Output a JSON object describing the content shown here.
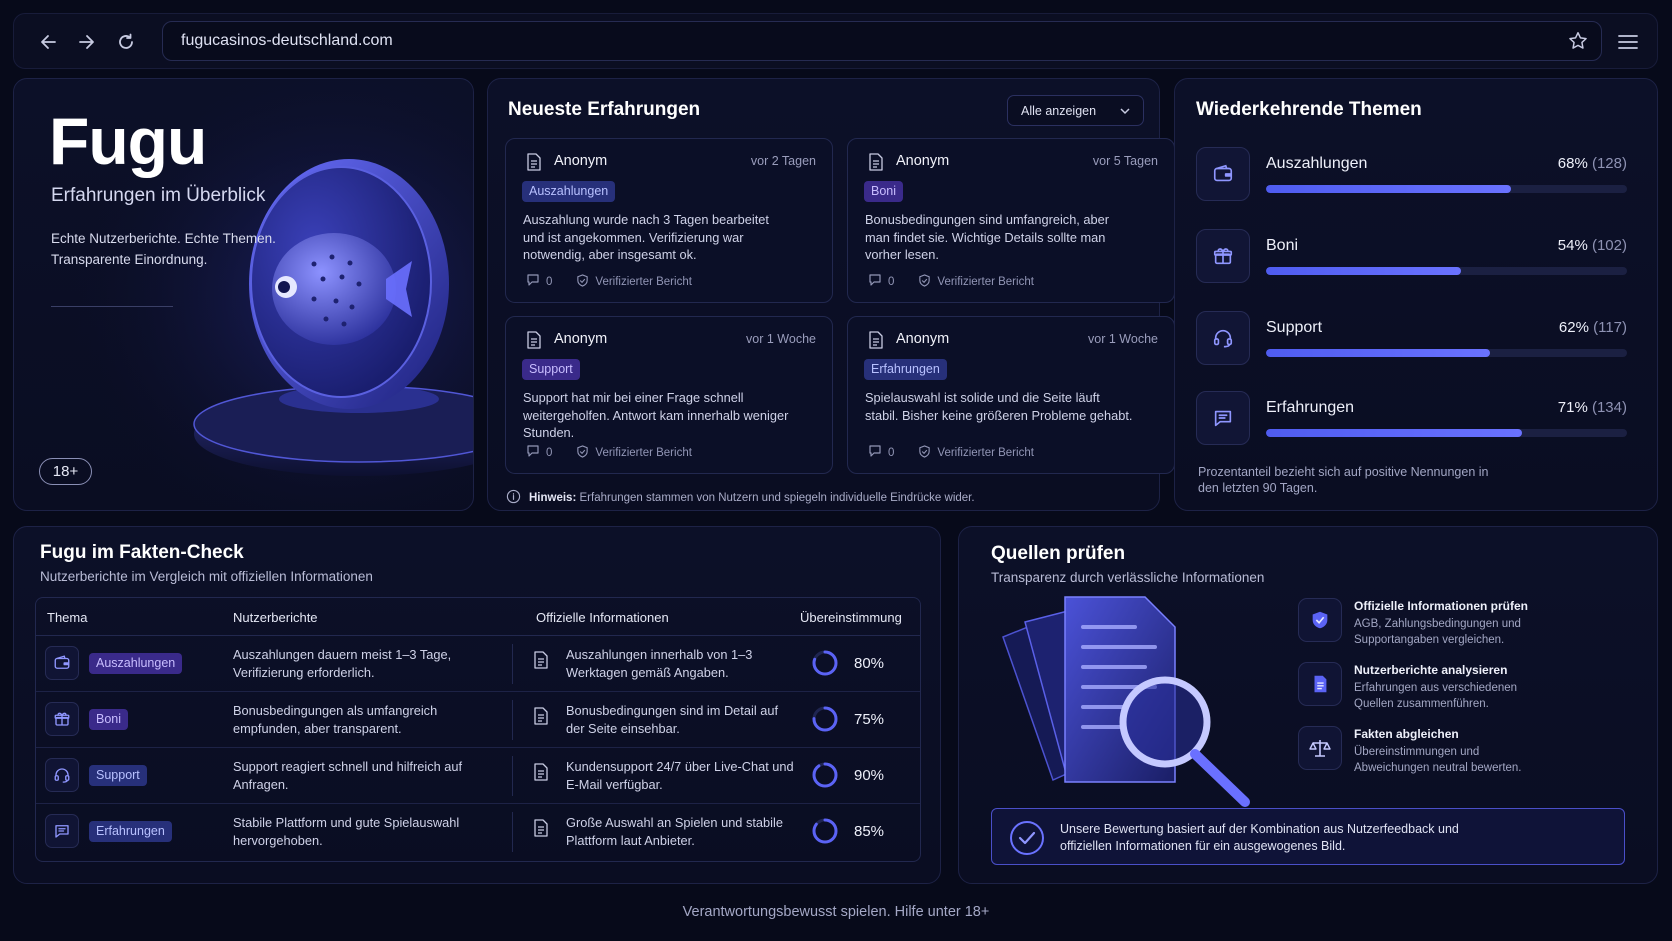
{
  "browser": {
    "url": "fugucasinos-deutschland.com",
    "back_icon": "arrow-left-icon",
    "forward_icon": "arrow-right-icon",
    "reload_icon": "reload-icon",
    "bookmark_icon": "star-icon",
    "menu_icon": "hamburger-menu-icon"
  },
  "hero": {
    "title": "Fugu",
    "subtitle": "Erfahrungen im Überblick",
    "description": "Echte Nutzerberichte. Echte Themen. Transparente Einordnung.",
    "age_badge": "18+"
  },
  "reviews": {
    "title": "Neueste Erfahrungen",
    "filter": "Alle anzeigen",
    "items": [
      {
        "author": "Anonym",
        "time": "vor 2 Tagen",
        "tag": "Auszahlungen",
        "text": "Auszahlung wurde nach 3 Tagen bearbeitet und ist angekommen. Verifizierung war notwendig, aber insgesamt ok.",
        "comments": "0",
        "verified": "Verifizierter Bericht"
      },
      {
        "author": "Anonym",
        "time": "vor 5 Tagen",
        "tag": "Boni",
        "text": "Bonusbedingungen sind umfangreich, aber man findet sie. Wichtige Details sollte man vorher lesen.",
        "comments": "0",
        "verified": "Verifizierter Bericht"
      },
      {
        "author": "Anonym",
        "time": "vor 1 Woche",
        "tag": "Support",
        "text": "Support hat mir bei einer Frage schnell weitergeholfen. Antwort kam innerhalb weniger Stunden.",
        "comments": "0",
        "verified": "Verifizierter Bericht"
      },
      {
        "author": "Anonym",
        "time": "vor 1 Woche",
        "tag": "Erfahrungen",
        "text": "Spielauswahl ist solide und die Seite läuft stabil. Bisher keine größeren Probleme gehabt.",
        "comments": "0",
        "verified": "Verifizierter Bericht"
      }
    ],
    "hint_label": "Hinweis:",
    "hint_text": "Erfahrungen stammen von Nutzern und spiegeln individuelle Eindrücke wider."
  },
  "themes": {
    "title": "Wiederkehrende Themen",
    "items": [
      {
        "label": "Auszahlungen",
        "percent": "68%",
        "count": "(128)",
        "value": 0.68,
        "icon": "wallet-icon"
      },
      {
        "label": "Boni",
        "percent": "54%",
        "count": "(102)",
        "value": 0.54,
        "icon": "gift-icon"
      },
      {
        "label": "Support",
        "percent": "62%",
        "count": "(117)",
        "value": 0.62,
        "icon": "headset-icon"
      },
      {
        "label": "Erfahrungen",
        "percent": "71%",
        "count": "(134)",
        "value": 0.71,
        "icon": "chat-icon"
      }
    ],
    "note": "Prozentanteil bezieht sich auf positive Nennungen in den letzten 90 Tagen."
  },
  "factcheck": {
    "title": "Fugu im Fakten-Check",
    "subtitle": "Nutzerberichte im Vergleich mit offiziellen Informationen",
    "headers": [
      "Thema",
      "Nutzerberichte",
      "Offizielle Informationen",
      "Übereinstimmung"
    ],
    "rows": [
      {
        "tag": "Auszahlungen",
        "user": "Auszahlungen dauern meist 1–3 Tage, Verifizierung erforderlich.",
        "official": "Auszahlungen innerhalb von 1–3 Werktagen gemäß Angaben.",
        "match": "80%",
        "value": 0.8,
        "icon": "wallet-icon"
      },
      {
        "tag": "Boni",
        "user": "Bonusbedingungen als umfangreich empfunden, aber transparent.",
        "official": "Bonusbedingungen sind im Detail auf der Seite einsehbar.",
        "match": "75%",
        "value": 0.75,
        "icon": "gift-icon"
      },
      {
        "tag": "Support",
        "user": "Support reagiert schnell und hilfreich auf Anfragen.",
        "official": "Kundensupport 24/7 über Live-Chat und E-Mail verfügbar.",
        "match": "90%",
        "value": 0.9,
        "icon": "headset-icon"
      },
      {
        "tag": "Erfahrungen",
        "user": "Stabile Plattform und gute Spielauswahl hervorgehoben.",
        "official": "Große Auswahl an Spielen und stabile Plattform laut Anbieter.",
        "match": "85%",
        "value": 0.85,
        "icon": "chat-icon"
      }
    ]
  },
  "sources": {
    "title": "Quellen prüfen",
    "subtitle": "Transparenz durch verlässliche Informationen",
    "items": [
      {
        "title": "Offizielle Informationen prüfen",
        "desc": "AGB, Zahlungsbedingungen und Supportangaben vergleichen.",
        "icon": "shield-icon"
      },
      {
        "title": "Nutzerberichte analysieren",
        "desc": "Erfahrungen aus verschiedenen Quellen zusammenführen.",
        "icon": "document-icon"
      },
      {
        "title": "Fakten abgleichen",
        "desc": "Übereinstimmungen und Abweichungen neutral bewerten.",
        "icon": "scales-icon"
      }
    ],
    "summary": "Unsere Bewertung basiert auf der Kombination aus Nutzerfeedback und offiziellen Informationen für ein ausgewogenes Bild."
  },
  "footer": "Verantwortungsbewusst spielen. Hilfe unter 18+",
  "colors": {
    "accent": "#5b63f5",
    "tag_blue": "#27307a",
    "tag_purple": "#3a2a8a",
    "background": "#070a1a"
  }
}
